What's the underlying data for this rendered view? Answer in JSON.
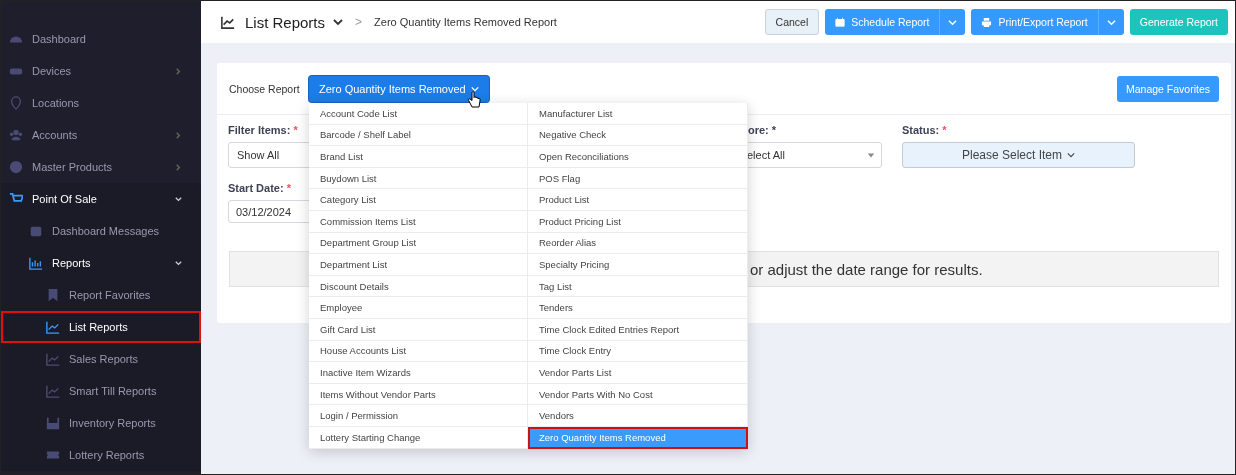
{
  "sidebar": {
    "items": [
      {
        "label": "Dashboard",
        "selected": false
      },
      {
        "label": "Devices",
        "selected": false,
        "expanded": false
      },
      {
        "label": "Locations",
        "selected": false
      },
      {
        "label": "Accounts",
        "selected": false,
        "expanded": false
      },
      {
        "label": "Master Products",
        "selected": false,
        "expanded": false
      },
      {
        "label": "Point Of Sale",
        "selected": false,
        "expanded": true,
        "children": [
          {
            "label": "Dashboard Messages",
            "selected": false
          },
          {
            "label": "Reports",
            "selected": false,
            "expanded": true,
            "children": [
              {
                "label": "Report Favorites",
                "selected": false
              },
              {
                "label": "List Reports",
                "selected": true
              },
              {
                "label": "Sales Reports",
                "selected": false
              },
              {
                "label": "Smart Till Reports",
                "selected": false
              },
              {
                "label": "Inventory Reports",
                "selected": false
              },
              {
                "label": "Lottery Reports",
                "selected": false
              }
            ]
          }
        ]
      }
    ]
  },
  "header": {
    "title": "List Reports",
    "separator": ">",
    "breadcrumb": "Zero Quantity Items Removed Report",
    "buttons": [
      {
        "label": "Cancel",
        "kind": "light"
      },
      {
        "label": "Schedule Report",
        "kind": "split"
      },
      {
        "label": "Print/Export Report",
        "kind": "split"
      },
      {
        "label": "Generate Report",
        "kind": "teal"
      }
    ]
  },
  "choose_report": {
    "label": "Choose Report",
    "value": "Zero Quantity Items Removed",
    "expanded": true,
    "manage_button": "Manage Favorites"
  },
  "report_menu": {
    "columns": [
      [
        {
          "label": "Account Code List",
          "selected": false
        },
        {
          "label": "Barcode / Shelf Label",
          "selected": false
        },
        {
          "label": "Brand List",
          "selected": false
        },
        {
          "label": "Buydown List",
          "selected": false
        },
        {
          "label": "Category List",
          "selected": false
        },
        {
          "label": "Commission Items List",
          "selected": false
        },
        {
          "label": "Department Group List",
          "selected": false
        },
        {
          "label": "Department List",
          "selected": false
        },
        {
          "label": "Discount Details",
          "selected": false
        },
        {
          "label": "Employee",
          "selected": false
        },
        {
          "label": "Gift Card List",
          "selected": false
        },
        {
          "label": "House Accounts List",
          "selected": false
        },
        {
          "label": "Inactive Item Wizards",
          "selected": false
        },
        {
          "label": "Items Without Vendor Parts",
          "selected": false
        },
        {
          "label": "Login / Permission",
          "selected": false
        },
        {
          "label": "Lottery Starting Change",
          "selected": false
        }
      ],
      [
        {
          "label": "Manufacturer List",
          "selected": false
        },
        {
          "label": "Negative Check",
          "selected": false
        },
        {
          "label": "Open Reconciliations",
          "selected": false
        },
        {
          "label": "POS Flag",
          "selected": false
        },
        {
          "label": "Product List",
          "selected": false
        },
        {
          "label": "Product Pricing List",
          "selected": false
        },
        {
          "label": "Reorder Alias",
          "selected": false
        },
        {
          "label": "Specialty Pricing",
          "selected": false
        },
        {
          "label": "Tag List",
          "selected": false
        },
        {
          "label": "Tenders",
          "selected": false
        },
        {
          "label": "Time Clock Edited Entries Report",
          "selected": false
        },
        {
          "label": "Time Clock Entry",
          "selected": false
        },
        {
          "label": "Vendor Parts List",
          "selected": false
        },
        {
          "label": "Vendor Parts With No Cost",
          "selected": false
        },
        {
          "label": "Vendors",
          "selected": false
        },
        {
          "label": "Zero Quantity Items Removed",
          "selected": true
        }
      ]
    ]
  },
  "filters": {
    "filter_items": {
      "label": "Filter Items:",
      "required": "*",
      "value": "Show All"
    },
    "store": {
      "label": "ore:",
      "required": "*",
      "value": "elect All"
    },
    "status": {
      "label": "Status:",
      "required": "*",
      "value": "Please Select Item"
    },
    "start_date": {
      "label": "Start Date:",
      "required": "*",
      "value": "03/12/2024"
    }
  },
  "message": "or adjust the date range for results."
}
